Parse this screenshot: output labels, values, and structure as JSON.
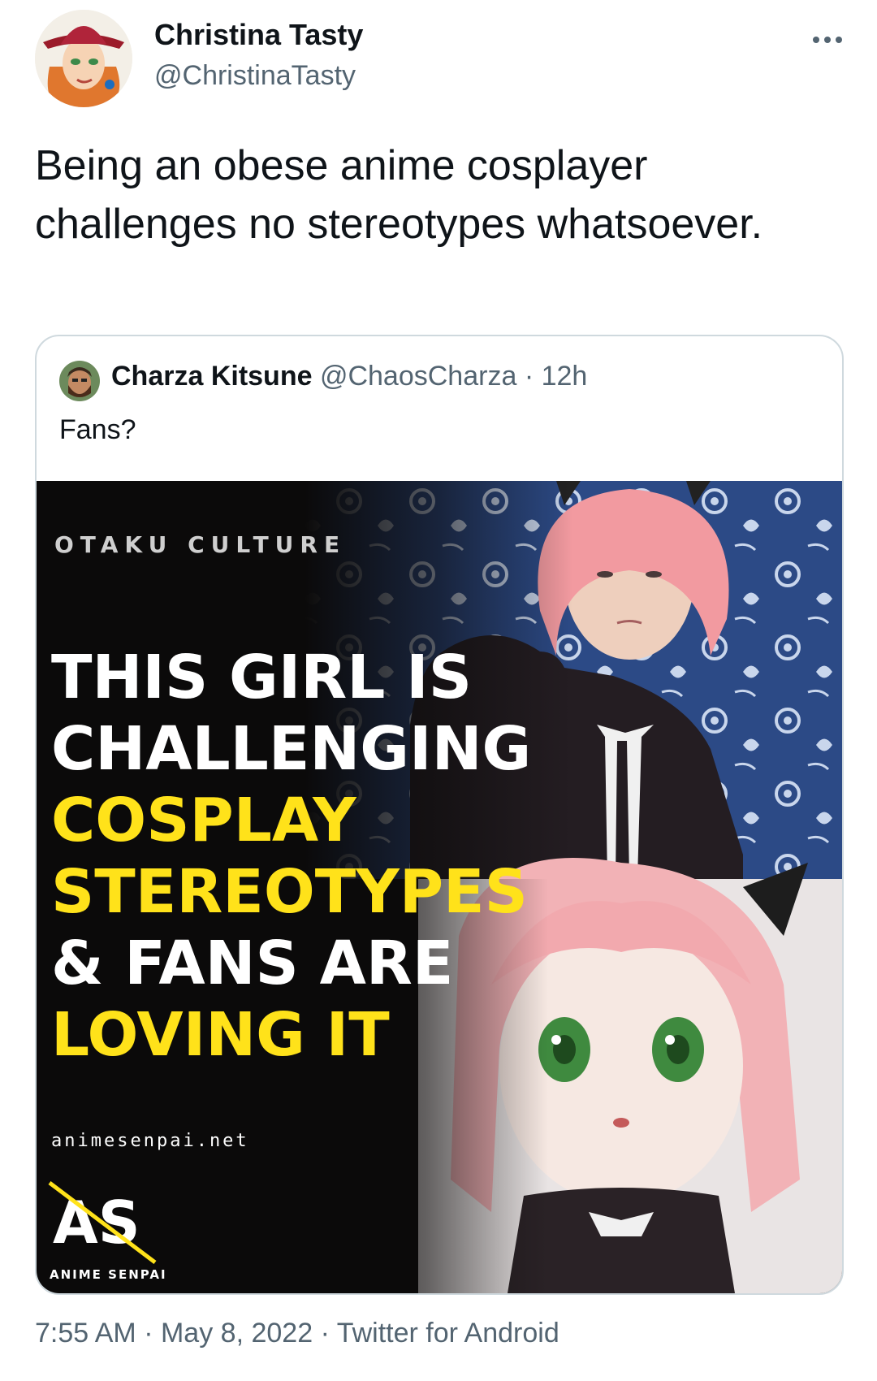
{
  "tweet": {
    "author_name": "Christina Tasty",
    "author_handle": "@ChristinaTasty",
    "text": "Being an obese anime cosplayer challenges no stereotypes whatsoever.",
    "more_icon": "ellipsis-icon"
  },
  "quoted_tweet": {
    "author_name": "Charza Kitsune",
    "author_handle": "@ChaosCharza",
    "separator": "·",
    "age": "12h",
    "text": "Fans?",
    "image": {
      "kicker": "OTAKU CULTURE",
      "headline": {
        "line1": "THIS GIRL IS",
        "line2": "CHALLENGING",
        "line3": "COSPLAY",
        "line4": "STEREOTYPES",
        "line5": "& FANS ARE",
        "line6": "LOVING IT"
      },
      "domain": "animesenpai.net",
      "logo_mark": "AS",
      "logo_text": "ANIME SENPAI"
    }
  },
  "footer": {
    "time": "7:55 AM",
    "sep1": "·",
    "date": "May 8, 2022",
    "sep2": "·",
    "source": "Twitter for Android"
  },
  "colors": {
    "text_primary": "#0f1419",
    "text_secondary": "#536471",
    "border": "#cfd9de",
    "headline_yellow": "#ffe21a"
  }
}
